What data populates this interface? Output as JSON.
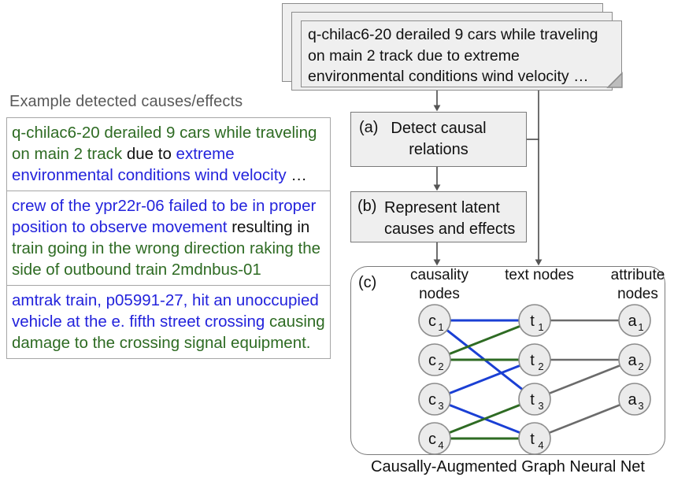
{
  "left": {
    "title": "Example detected causes/effects",
    "examples": [
      {
        "segments": [
          {
            "text": "q-chilac6-20 derailed 9 cars while traveling on main 2 track ",
            "role": "effect"
          },
          {
            "text": "due to ",
            "role": "link"
          },
          {
            "text": "extreme environmental conditions wind velocity ",
            "role": "cause"
          },
          {
            "text": "…",
            "role": "link"
          }
        ]
      },
      {
        "segments": [
          {
            "text": "crew of the ypr22r-06 failed to be in proper position to observe movement ",
            "role": "cause"
          },
          {
            "text": "resulting in ",
            "role": "link"
          },
          {
            "text": "train going in the wrong direction raking the side of outbound train 2mdnbus-01",
            "role": "effect"
          }
        ]
      },
      {
        "segments": [
          {
            "text": "amtrak train, p05991-27, hit an unoccupied vehicle at the e. fifth street crossing ",
            "role": "cause"
          },
          {
            "text": "causing damage to the crossing signal equipment.",
            "role": "effect"
          }
        ]
      }
    ]
  },
  "cards": {
    "front_text": "q-chilac6-20 derailed 9 cars while traveling on main 2 track due to extreme environmental conditions wind velocity …",
    "count": 3
  },
  "pipeline": {
    "box_a": {
      "label": "(a)",
      "text": "Detect causal relations"
    },
    "box_b": {
      "label": "(b)",
      "text": "Represent latent causes and effects"
    },
    "box_c": {
      "label": "(c)",
      "caption": "Causally-Augmented Graph Neural Net"
    }
  },
  "gnn": {
    "column_headings": [
      "causality nodes",
      "text nodes",
      "attribute nodes"
    ],
    "nodes": {
      "causality": [
        {
          "base": "c",
          "sub": "1"
        },
        {
          "base": "c",
          "sub": "2"
        },
        {
          "base": "c",
          "sub": "3"
        },
        {
          "base": "c",
          "sub": "4"
        }
      ],
      "text": [
        {
          "base": "t",
          "sub": "1"
        },
        {
          "base": "t",
          "sub": "2"
        },
        {
          "base": "t",
          "sub": "3"
        },
        {
          "base": "t",
          "sub": "4"
        }
      ],
      "attribute": [
        {
          "base": "a",
          "sub": "1"
        },
        {
          "base": "a",
          "sub": "2"
        },
        {
          "base": "a",
          "sub": "3"
        }
      ]
    },
    "edges": [
      {
        "from": "c1",
        "to": "t1",
        "color": "#1a3fd4",
        "kind": "cause"
      },
      {
        "from": "c1",
        "to": "t3",
        "color": "#1a3fd4",
        "kind": "cause"
      },
      {
        "from": "c3",
        "to": "t2",
        "color": "#1a3fd4",
        "kind": "cause"
      },
      {
        "from": "c3",
        "to": "t4",
        "color": "#1a3fd4",
        "kind": "cause"
      },
      {
        "from": "c2",
        "to": "t1",
        "color": "#2e6b23",
        "kind": "effect"
      },
      {
        "from": "c2",
        "to": "t2",
        "color": "#2e6b23",
        "kind": "effect"
      },
      {
        "from": "c4",
        "to": "t3",
        "color": "#2e6b23",
        "kind": "effect"
      },
      {
        "from": "c4",
        "to": "t4",
        "color": "#2e6b23",
        "kind": "effect"
      },
      {
        "from": "t1",
        "to": "a1",
        "color": "#6b6b6b",
        "kind": "attribute"
      },
      {
        "from": "t2",
        "to": "a2",
        "color": "#6b6b6b",
        "kind": "attribute"
      },
      {
        "from": "t3",
        "to": "a2",
        "color": "#6b6b6b",
        "kind": "attribute"
      },
      {
        "from": "t4",
        "to": "a3",
        "color": "#6b6b6b",
        "kind": "attribute"
      }
    ]
  },
  "colors": {
    "cause_blue": "#2323dc",
    "effect_green": "#2e6b23",
    "link_black": "#111111",
    "box_fill": "#efefef",
    "box_stroke": "#7a7a7a",
    "node_fill": "#ebebeb",
    "connector_gray": "#6b6b6b",
    "title_gray": "#595959"
  }
}
